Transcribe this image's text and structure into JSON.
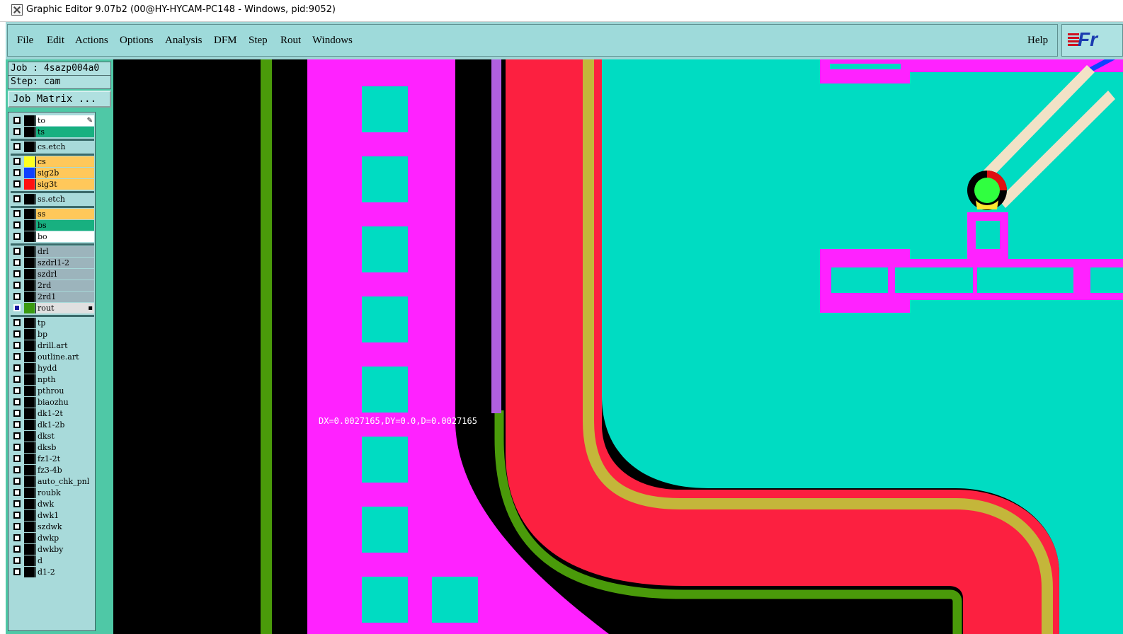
{
  "window": {
    "title": "Graphic Editor 9.07b2 (00@HY-HYCAM-PC148 - Windows, pid:9052)"
  },
  "menu": {
    "items": [
      "File",
      "Edit",
      "Actions",
      "Options",
      "Analysis",
      "DFM",
      "Step",
      "Rout",
      "Windows"
    ],
    "help": "Help",
    "logo_text": "Fr"
  },
  "job": {
    "job_line": "Job : 4sazp004a0",
    "step_line": "Step: cam",
    "matrix_button": "Job Matrix ..."
  },
  "layers": [
    {
      "name": "to",
      "color": "#ffffff",
      "swatch": "#000000",
      "marker": "pen"
    },
    {
      "name": "ts",
      "color": "#18b080",
      "swatch": "#000000"
    },
    {
      "sep": true
    },
    {
      "name": "cs.etch",
      "color": "#a8dada",
      "swatch": "#000000"
    },
    {
      "sep": true
    },
    {
      "name": "cs",
      "color": "#ffc85a",
      "swatch": "#ffff20"
    },
    {
      "name": "sig2b",
      "color": "#ffc85a",
      "swatch": "#1040ff"
    },
    {
      "name": "sig3t",
      "color": "#ffc85a",
      "swatch": "#ff1010"
    },
    {
      "sep": true
    },
    {
      "name": "ss.etch",
      "color": "#a8dada",
      "swatch": "#000000"
    },
    {
      "sep": true
    },
    {
      "name": "ss",
      "color": "#ffc85a",
      "swatch": "#000000"
    },
    {
      "name": "bs",
      "color": "#18b080",
      "swatch": "#000000"
    },
    {
      "name": "bo",
      "color": "#ffffff",
      "swatch": "#000000"
    },
    {
      "sep": true
    },
    {
      "name": "drl",
      "color": "#9cb4bc",
      "swatch": "#000000"
    },
    {
      "name": "szdrl1-2",
      "color": "#9cb4bc",
      "swatch": "#000000"
    },
    {
      "name": "szdrl",
      "color": "#9cb4bc",
      "swatch": "#000000"
    },
    {
      "name": "2rd",
      "color": "#9cb4bc",
      "swatch": "#000000"
    },
    {
      "name": "2rd1",
      "color": "#9cb4bc",
      "swatch": "#000000"
    },
    {
      "name": "rout",
      "color": "#e0e0e0",
      "swatch": "#3a9a10",
      "selected": true,
      "marker": "box"
    },
    {
      "sep": true
    },
    {
      "name": "tp",
      "color": "#a8dada",
      "swatch": "#000000"
    },
    {
      "name": "bp",
      "color": "#a8dada",
      "swatch": "#000000"
    },
    {
      "name": "drill.art",
      "color": "#a8dada",
      "swatch": "#000000"
    },
    {
      "name": "outline.art",
      "color": "#a8dada",
      "swatch": "#000000"
    },
    {
      "name": "hydd",
      "color": "#a8dada",
      "swatch": "#000000"
    },
    {
      "name": "npth",
      "color": "#a8dada",
      "swatch": "#000000"
    },
    {
      "name": "pthrou",
      "color": "#a8dada",
      "swatch": "#000000"
    },
    {
      "name": "biaozhu",
      "color": "#a8dada",
      "swatch": "#000000"
    },
    {
      "name": "dk1-2t",
      "color": "#a8dada",
      "swatch": "#000000"
    },
    {
      "name": "dk1-2b",
      "color": "#a8dada",
      "swatch": "#000000"
    },
    {
      "name": "dkst",
      "color": "#a8dada",
      "swatch": "#000000"
    },
    {
      "name": "dksb",
      "color": "#a8dada",
      "swatch": "#000000"
    },
    {
      "name": "fz1-2t",
      "color": "#a8dada",
      "swatch": "#000000"
    },
    {
      "name": "fz3-4b",
      "color": "#a8dada",
      "swatch": "#000000"
    },
    {
      "name": "auto_chk_pnl",
      "color": "#a8dada",
      "swatch": "#000000"
    },
    {
      "name": "roubk",
      "color": "#a8dada",
      "swatch": "#000000"
    },
    {
      "name": "dwk",
      "color": "#a8dada",
      "swatch": "#000000"
    },
    {
      "name": "dwk1",
      "color": "#a8dada",
      "swatch": "#000000"
    },
    {
      "name": "szdwk",
      "color": "#a8dada",
      "swatch": "#000000"
    },
    {
      "name": "dwkp",
      "color": "#a8dada",
      "swatch": "#000000"
    },
    {
      "name": "dwkby",
      "color": "#a8dada",
      "swatch": "#000000"
    },
    {
      "name": "d",
      "color": "#a8dada",
      "swatch": "#000000"
    },
    {
      "name": "d1-2",
      "color": "#a8dada",
      "swatch": "#000000"
    }
  ],
  "canvas": {
    "readout": "DX=0.0027165,DY=0.0,D=0.0027165",
    "colors": {
      "background": "#000000",
      "magenta": "#ff22ff",
      "cyan": "#00dcc2",
      "red": "#fc2040",
      "olive": "#c4b63a",
      "green": "#4a9a0a",
      "violet": "#b060e0",
      "pad_green": "#30ff40",
      "trace": "#f2e2c6",
      "pad_yellow": "#ffe830",
      "pad_red": "#e01010"
    }
  }
}
